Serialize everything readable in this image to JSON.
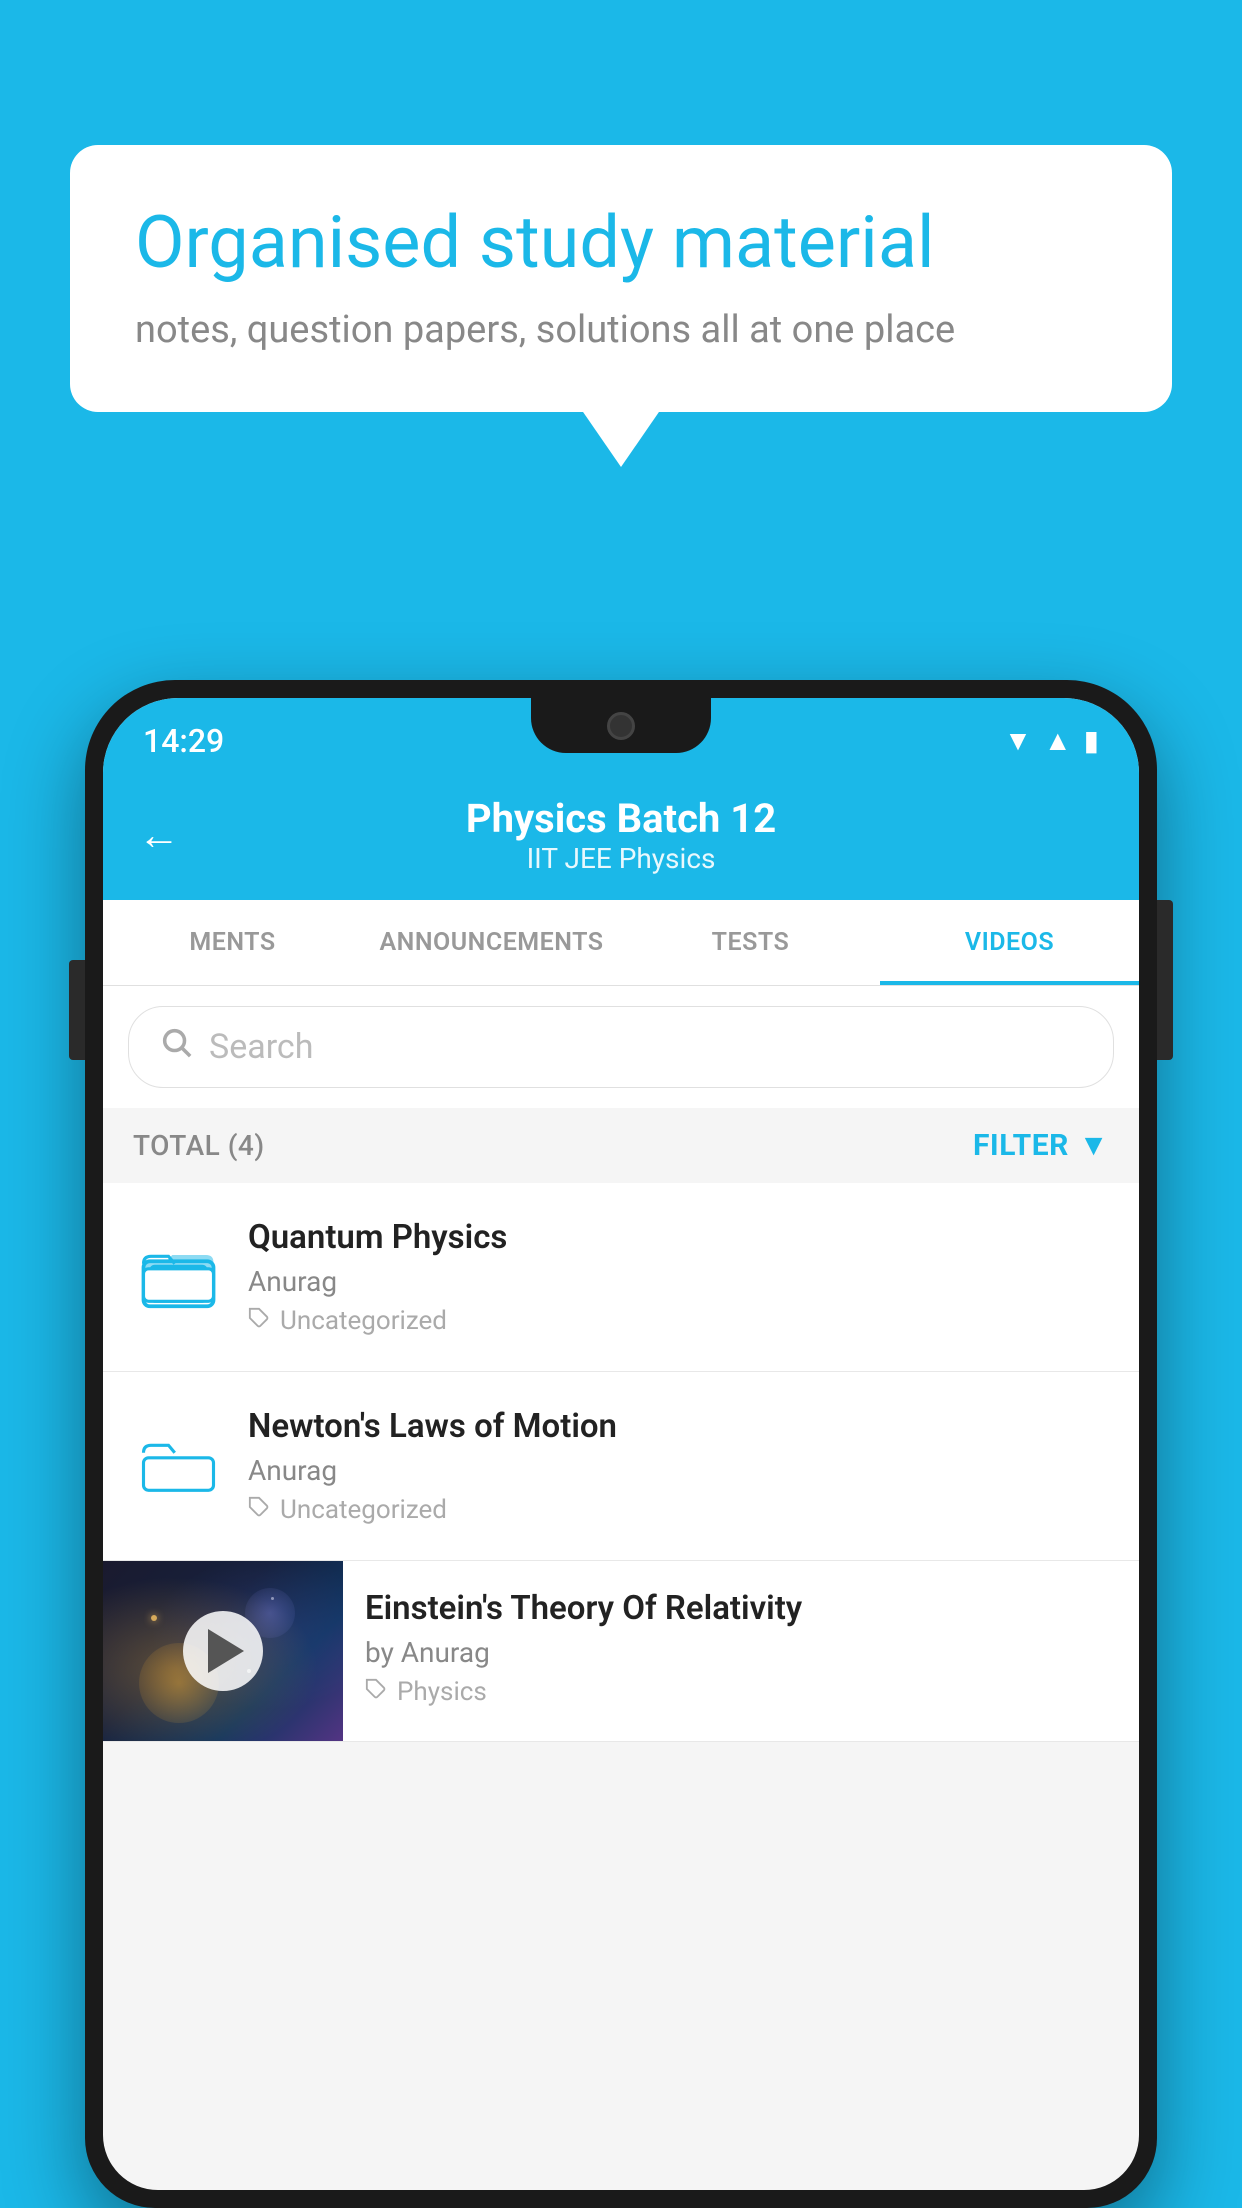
{
  "background": {
    "color": "#1bb8e8"
  },
  "speech_bubble": {
    "title": "Organised study material",
    "subtitle": "notes, question papers, solutions all at one place"
  },
  "phone": {
    "status_bar": {
      "time": "14:29",
      "icons": [
        "wifi",
        "signal",
        "battery"
      ]
    },
    "header": {
      "title": "Physics Batch 12",
      "subtitle": "IIT JEE   Physics",
      "back_label": "←"
    },
    "tabs": [
      {
        "label": "MENTS",
        "active": false
      },
      {
        "label": "ANNOUNCEMENTS",
        "active": false
      },
      {
        "label": "TESTS",
        "active": false
      },
      {
        "label": "VIDEOS",
        "active": true
      }
    ],
    "search": {
      "placeholder": "Search"
    },
    "filter_bar": {
      "total_label": "TOTAL (4)",
      "filter_label": "FILTER"
    },
    "videos": [
      {
        "title": "Quantum Physics",
        "author": "Anurag",
        "tag": "Uncategorized",
        "type": "folder"
      },
      {
        "title": "Newton's Laws of Motion",
        "author": "Anurag",
        "tag": "Uncategorized",
        "type": "folder"
      },
      {
        "title": "Einstein's Theory Of Relativity",
        "author": "by Anurag",
        "tag": "Physics",
        "type": "video"
      }
    ]
  }
}
